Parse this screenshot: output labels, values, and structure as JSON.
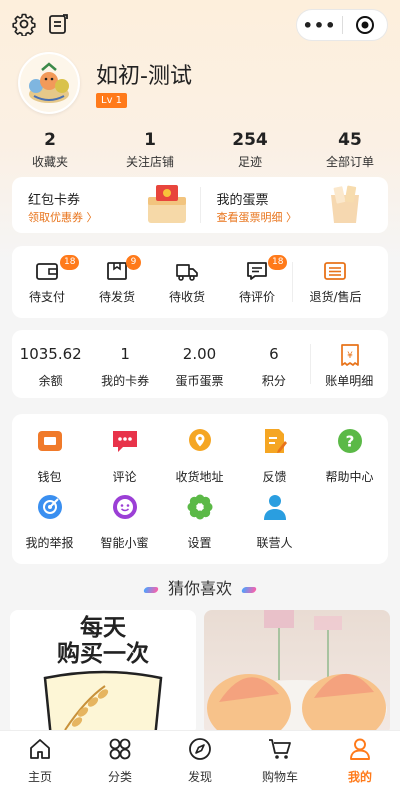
{
  "header": {
    "icons": [
      "gear-icon",
      "edit-note-icon",
      "more-dots-icon",
      "target-icon"
    ],
    "more_label": "•••"
  },
  "profile": {
    "name": "如初-测试",
    "level": "Lv 1"
  },
  "stats": [
    {
      "value": "2",
      "label": "收藏夹"
    },
    {
      "value": "1",
      "label": "关注店铺"
    },
    {
      "value": "254",
      "label": "足迹"
    },
    {
      "value": "45",
      "label": "全部订单"
    }
  ],
  "coupons": {
    "left": {
      "title": "红包卡券",
      "link": "领取优惠券 〉"
    },
    "right": {
      "title": "我的蛋票",
      "link": "查看蛋票明细 〉"
    }
  },
  "orders": [
    {
      "label": "待支付",
      "badge": "18",
      "icon": "wallet-icon"
    },
    {
      "label": "待发货",
      "badge": "9",
      "icon": "package-icon"
    },
    {
      "label": "待收货",
      "badge": "",
      "icon": "truck-icon"
    },
    {
      "label": "待评价",
      "badge": "18",
      "icon": "comment-icon"
    },
    {
      "label": "退货/售后",
      "badge": "",
      "icon": "return-icon"
    }
  ],
  "wallet": [
    {
      "value": "1035.62",
      "label": "余额"
    },
    {
      "value": "1",
      "label": "我的卡券"
    },
    {
      "value": "2.00",
      "label": "蛋币蛋票"
    },
    {
      "value": "6",
      "label": "积分"
    },
    {
      "label": "账单明细",
      "icon": "bill-icon"
    }
  ],
  "tools": [
    {
      "label": "钱包",
      "icon": "wallet-icon",
      "color": "#f07a2a"
    },
    {
      "label": "评论",
      "icon": "comment-icon",
      "color": "#e8334a"
    },
    {
      "label": "收货地址",
      "icon": "location-icon",
      "color": "#f5a623"
    },
    {
      "label": "反馈",
      "icon": "feedback-icon",
      "color": "#f5a623"
    },
    {
      "label": "帮助中心",
      "icon": "help-icon",
      "color": "#5bb947"
    },
    {
      "label": "我的举报",
      "icon": "report-icon",
      "color": "#3a8ff0"
    },
    {
      "label": "智能小蜜",
      "icon": "assistant-icon",
      "color": "#9b3fd6"
    },
    {
      "label": "设置",
      "icon": "settings-icon",
      "color": "#5bb947"
    },
    {
      "label": "联营人",
      "icon": "person-icon",
      "color": "#2a9ee0"
    }
  ],
  "recommend": {
    "title": "猜你喜欢",
    "product1_text": [
      "每天",
      "购买一次"
    ]
  },
  "tabbar": [
    {
      "label": "主页",
      "icon": "home-icon"
    },
    {
      "label": "分类",
      "icon": "category-icon"
    },
    {
      "label": "发现",
      "icon": "compass-icon"
    },
    {
      "label": "购物车",
      "icon": "cart-icon"
    },
    {
      "label": "我的",
      "icon": "user-icon",
      "active": true
    }
  ],
  "colors": {
    "accent": "#ff7a1a",
    "link": "#e8731a"
  }
}
